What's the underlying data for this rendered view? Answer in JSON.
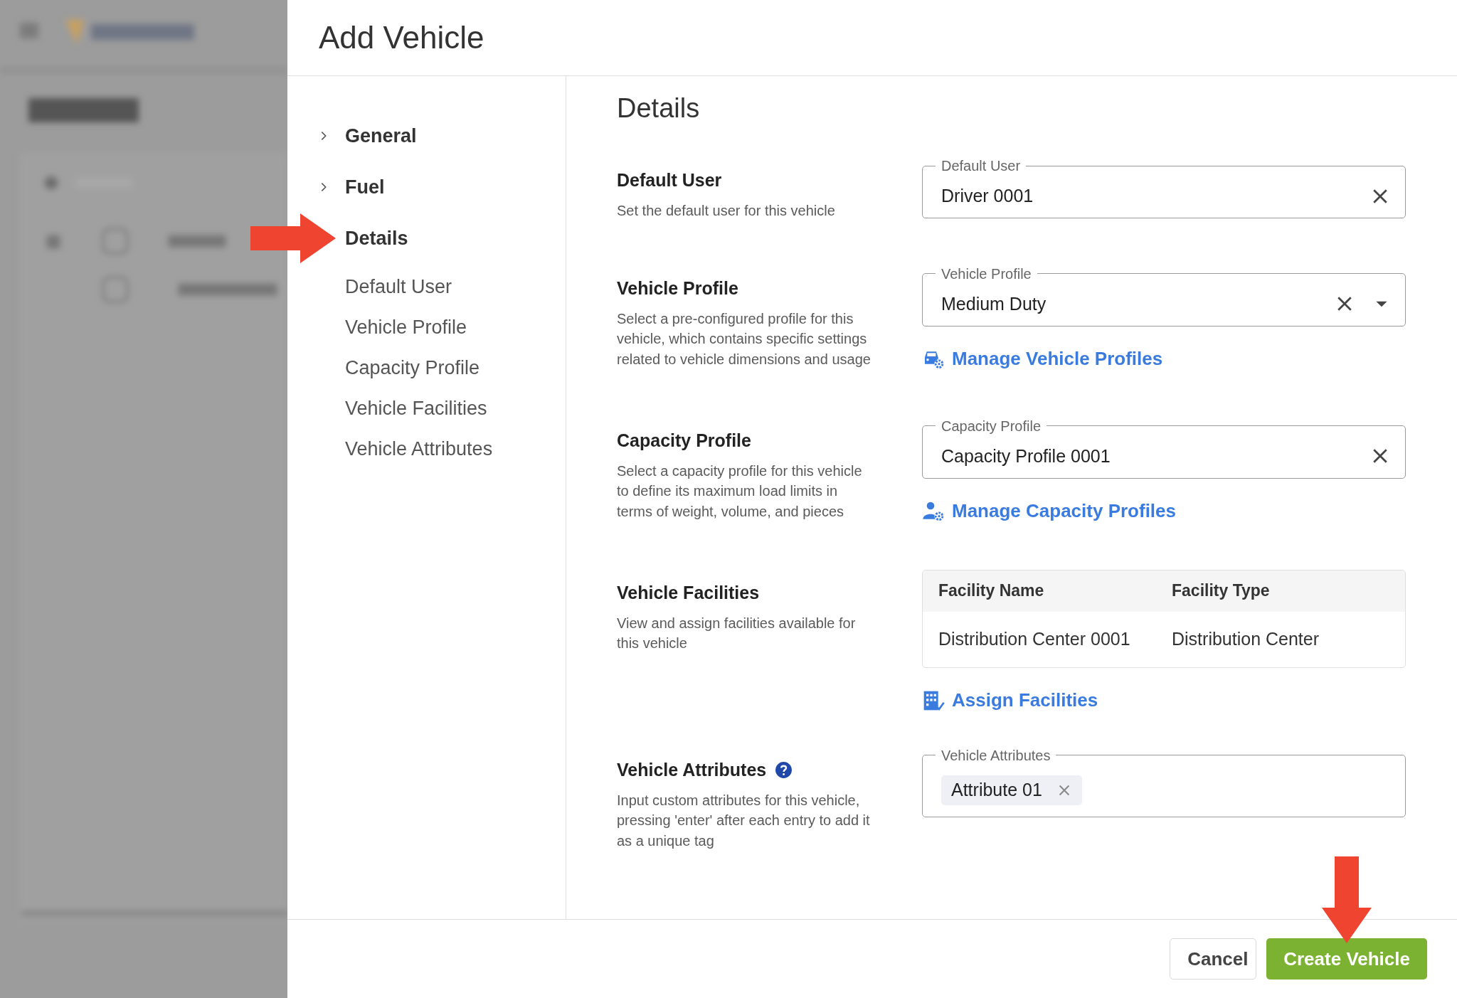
{
  "modal": {
    "title": "Add Vehicle"
  },
  "nav": [
    {
      "label": "General",
      "kind": "group",
      "expanded": false
    },
    {
      "label": "Fuel",
      "kind": "group",
      "expanded": false
    },
    {
      "label": "Details",
      "kind": "heading"
    },
    {
      "label": "Default User",
      "kind": "sub"
    },
    {
      "label": "Vehicle Profile",
      "kind": "sub"
    },
    {
      "label": "Capacity Profile",
      "kind": "sub"
    },
    {
      "label": "Vehicle Facilities",
      "kind": "sub"
    },
    {
      "label": "Vehicle Attributes",
      "kind": "sub"
    }
  ],
  "section_title": "Details",
  "rows": [
    {
      "kind": "select",
      "title": "Default User",
      "description": "Set the default user for this vehicle",
      "field": {
        "label": "Default User",
        "value": "Driver 0001",
        "clearable": true
      }
    },
    {
      "kind": "select",
      "title": "Vehicle Profile",
      "description": "Select a pre-configured profile for this vehicle, which contains specific settings related to vehicle dimensions and usage",
      "field": {
        "label": "Vehicle Profile",
        "value": "Medium Duty",
        "clearable": true,
        "dropdown": true
      },
      "link": {
        "text": "Manage Vehicle Profiles",
        "kind": "vehicle"
      }
    },
    {
      "kind": "select",
      "title": "Capacity Profile",
      "description": "Select a capacity profile for this vehicle to define its maximum load limits in terms of weight, volume, and pieces",
      "field": {
        "label": "Capacity Profile",
        "value": "Capacity Profile 0001",
        "clearable": true
      },
      "link": {
        "text": "Manage Capacity Profiles",
        "kind": "capacity"
      }
    },
    {
      "kind": "table",
      "title": "Vehicle Facilities",
      "description": "View and assign facilities available for this vehicle",
      "table": {
        "columns": [
          "Facility Name",
          "Facility Type"
        ],
        "rows": [
          [
            "Distribution Center 0001",
            "Distribution Center"
          ]
        ]
      },
      "link": {
        "text": "Assign Facilities",
        "kind": "facilities"
      }
    },
    {
      "kind": "tags",
      "title": "Vehicle Attributes",
      "help": true,
      "description": "Input custom attributes for this vehicle, pressing 'enter' after each entry to add it as a unique tag",
      "field": {
        "label": "Vehicle Attributes",
        "tags": [
          "Attribute 01"
        ]
      }
    }
  ],
  "footer": {
    "buttons": [
      {
        "label": "Cancel",
        "kind": "secondary"
      },
      {
        "label": "Create Vehicle",
        "kind": "primary"
      }
    ]
  },
  "annotations": [
    {
      "kind": "rightarrow"
    },
    {
      "kind": "downarrow"
    }
  ]
}
